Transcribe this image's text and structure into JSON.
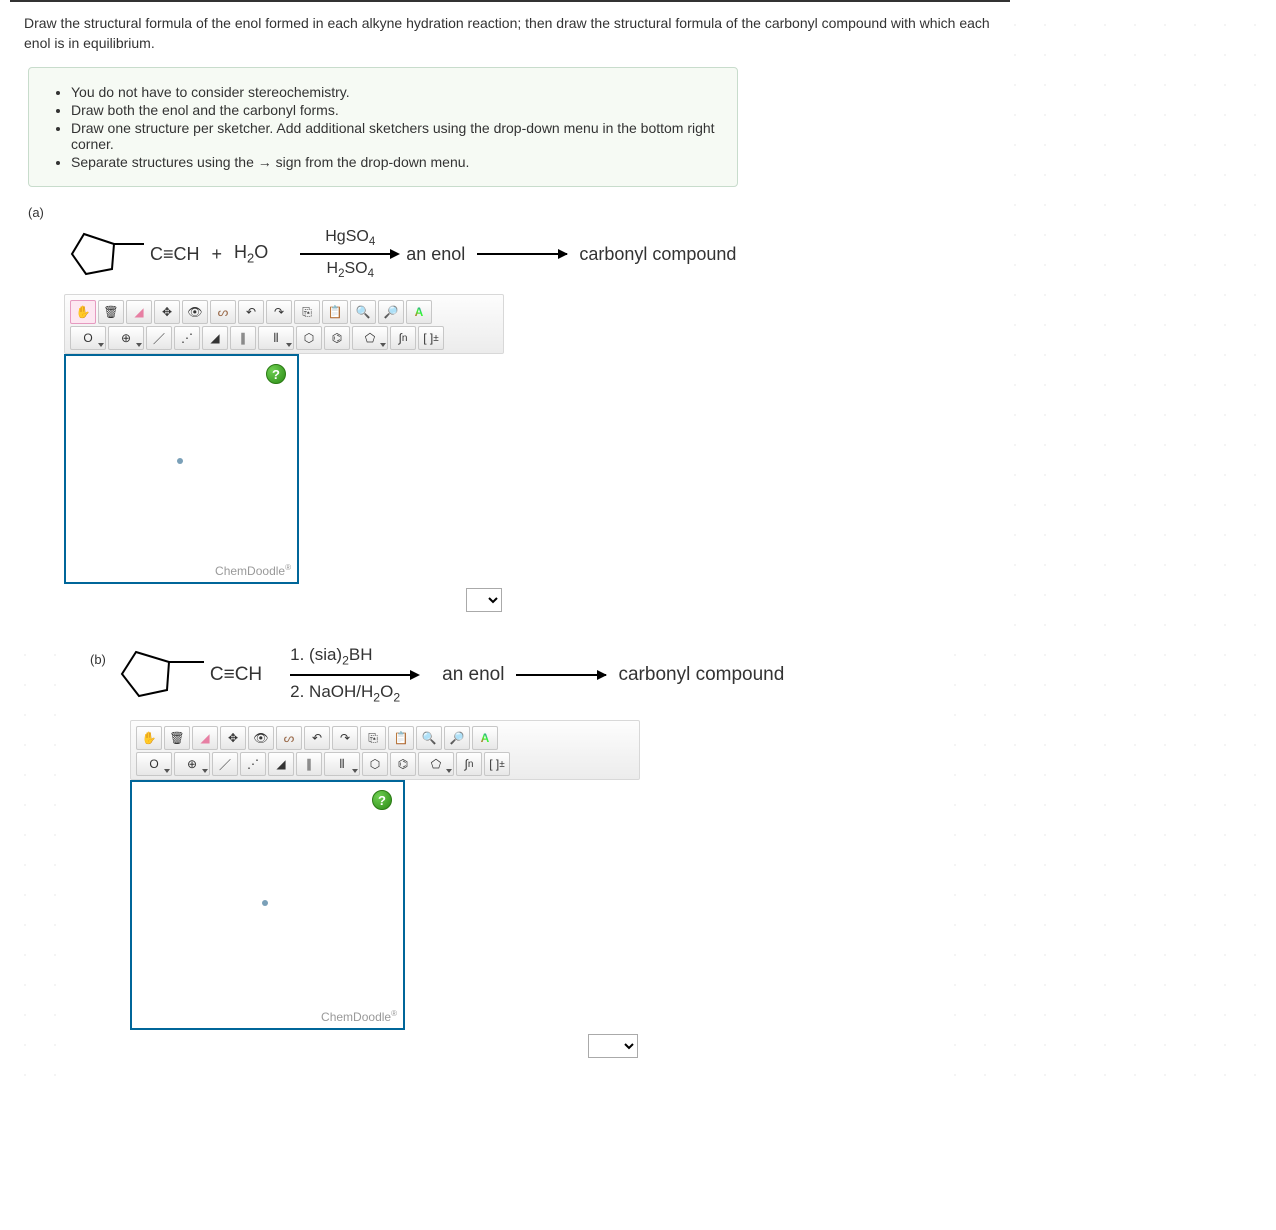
{
  "question": "Draw the structural formula of the enol formed in each alkyne hydration reaction; then draw the structural formula of the carbonyl compound with which each enol is in equilibrium.",
  "hints": [
    "You do not have to consider stereochemistry.",
    "Draw both the enol and the carbonyl forms.",
    "Draw one structure per sketcher. Add additional sketchers using the drop-down menu in the bottom right corner.",
    "Separate structures using the → sign from the drop-down menu."
  ],
  "parts": {
    "a": {
      "label": "(a)",
      "substrate": "cyclopentyl-C≡CH",
      "reagent_plus": "+",
      "reagent2": "H₂O",
      "cond_top": "HgSO₄",
      "cond_bot": "H₂SO₄",
      "product1": "an enol",
      "product2": "carbonyl compound"
    },
    "b": {
      "label": "(b)",
      "substrate": "cyclopentyl-C≡CH",
      "cond_line1": "1. (sia)₂BH",
      "cond_line2": "2. NaOH/H₂O₂",
      "product1": "an enol",
      "product2": "carbonyl compound"
    }
  },
  "toolbar": {
    "row1": [
      "hand",
      "trash",
      "eraser",
      "move",
      "view",
      "lasso",
      "undo",
      "redo",
      "copy",
      "paste",
      "zoom-in",
      "zoom-out",
      "color"
    ],
    "row2": [
      "element-O",
      "charge",
      "bond-single",
      "bond-dash",
      "bond-wedge",
      "bond-double",
      "bond-triple",
      "ring-cyclohexane",
      "ring-benzene",
      "ring-cyclopentane",
      "chain",
      "bracket"
    ]
  },
  "labels": {
    "element_O": "O",
    "chain_n": "n",
    "bracket": "[ ]",
    "help": "?",
    "brand": "ChemDoodle",
    "reg": "®",
    "charge": "⊕",
    "triple_C": "C≡CH"
  }
}
